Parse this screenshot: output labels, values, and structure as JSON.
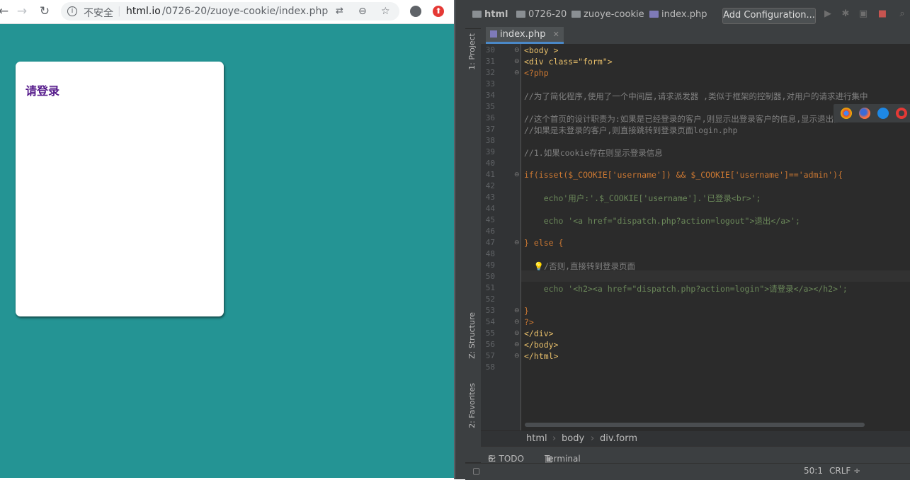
{
  "browser": {
    "url_security": "不安全",
    "url_host": "html.io",
    "url_path": "/0726-20/zuoye-cookie/index.php",
    "page_link": "请登录",
    "colors": {
      "page_bg": "#249494",
      "link": "#551a8b"
    }
  },
  "ide": {
    "breadcrumb": [
      "html",
      "0726-20",
      "zuoye-cookie",
      "index.php"
    ],
    "add_config_label": "Add Configuration...",
    "left_tabs": [
      "1: Project",
      "Z: Structure",
      "2: Favorites"
    ],
    "editor_tab": "index.php",
    "code_lines": [
      {
        "n": 30,
        "t": "<body >"
      },
      {
        "n": 31,
        "t": "<div class=\"form\">"
      },
      {
        "n": 32,
        "t": "<?php"
      },
      {
        "n": 33,
        "t": ""
      },
      {
        "n": 34,
        "t": "//为了简化程序,使用了一个中间层,请求派发器 ,类似于框架的控制器,对用户的请求进行集中"
      },
      {
        "n": 35,
        "t": ""
      },
      {
        "n": 36,
        "t": "//这个首页的设计职责为:如果是已经登录的客户,则显示出登录客户的信息,显示退出按钮."
      },
      {
        "n": 37,
        "t": "//如果是未登录的客户,则直接跳转到登录页面login.php"
      },
      {
        "n": 38,
        "t": ""
      },
      {
        "n": 39,
        "t": "//1.如果cookie存在则显示登录信息"
      },
      {
        "n": 40,
        "t": ""
      },
      {
        "n": 41,
        "t": "if(isset($_COOKIE['username']) && $_COOKIE['username']=='admin'){"
      },
      {
        "n": 42,
        "t": ""
      },
      {
        "n": 43,
        "t": "    echo'用户:'.$_COOKIE['username'].'已登录<br>';"
      },
      {
        "n": 44,
        "t": ""
      },
      {
        "n": 45,
        "t": "    echo '<a href=\"dispatch.php?action=logout\">退出</a>';"
      },
      {
        "n": 46,
        "t": ""
      },
      {
        "n": 47,
        "t": "} else {"
      },
      {
        "n": 48,
        "t": ""
      },
      {
        "n": 49,
        "t": "  💡/否则,直接转到登录页面"
      },
      {
        "n": 50,
        "t": ""
      },
      {
        "n": 51,
        "t": "    echo '<h2><a href=\"dispatch.php?action=login\">请登录</a></h2>';"
      },
      {
        "n": 52,
        "t": ""
      },
      {
        "n": 53,
        "t": "}"
      },
      {
        "n": 54,
        "t": "?>"
      },
      {
        "n": 55,
        "t": "</div>"
      },
      {
        "n": 56,
        "t": "</body>"
      },
      {
        "n": 57,
        "t": "</html>"
      },
      {
        "n": 58,
        "t": ""
      }
    ],
    "code_breadcrumb": [
      "html",
      "body",
      "div.form"
    ],
    "bottom_tabs": [
      "6: TODO",
      "Terminal"
    ],
    "status": {
      "position": "50:1",
      "line_sep": "CRLF ÷"
    },
    "colors": {
      "bg": "#2b2b2b",
      "panel": "#3c3f41",
      "keyword": "#cc7832",
      "string": "#6a8759",
      "comment": "#808080",
      "tag": "#e8bf6a"
    }
  }
}
